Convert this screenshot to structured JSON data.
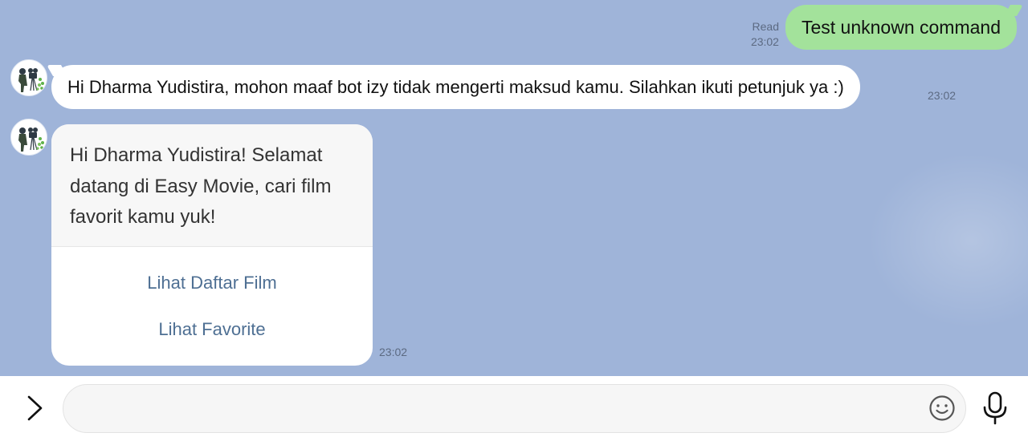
{
  "messages": {
    "outgoing": {
      "read_label": "Read",
      "time": "23:02",
      "text": "Test unknown command"
    },
    "incoming_text": {
      "text": "Hi Dharma Yudistira, mohon maaf bot izy tidak mengerti maksud kamu. Silahkan ikuti petunjuk ya :)",
      "time": "23:02"
    },
    "incoming_card": {
      "text": "Hi Dharma Yudistira! Selamat datang di Easy Movie, cari film favorit kamu yuk!",
      "buttons": [
        "Lihat Daftar Film",
        "Lihat Favorite"
      ],
      "time": "23:02"
    }
  },
  "input_bar": {
    "placeholder": "",
    "icons": [
      "chevron-right-icon",
      "emoji-icon",
      "microphone-icon"
    ]
  },
  "colors": {
    "chat_background": "#9fb4d9",
    "outgoing_bubble": "#a3e29b",
    "incoming_bubble": "#ffffff",
    "card_button_text": "#4e6f93"
  }
}
